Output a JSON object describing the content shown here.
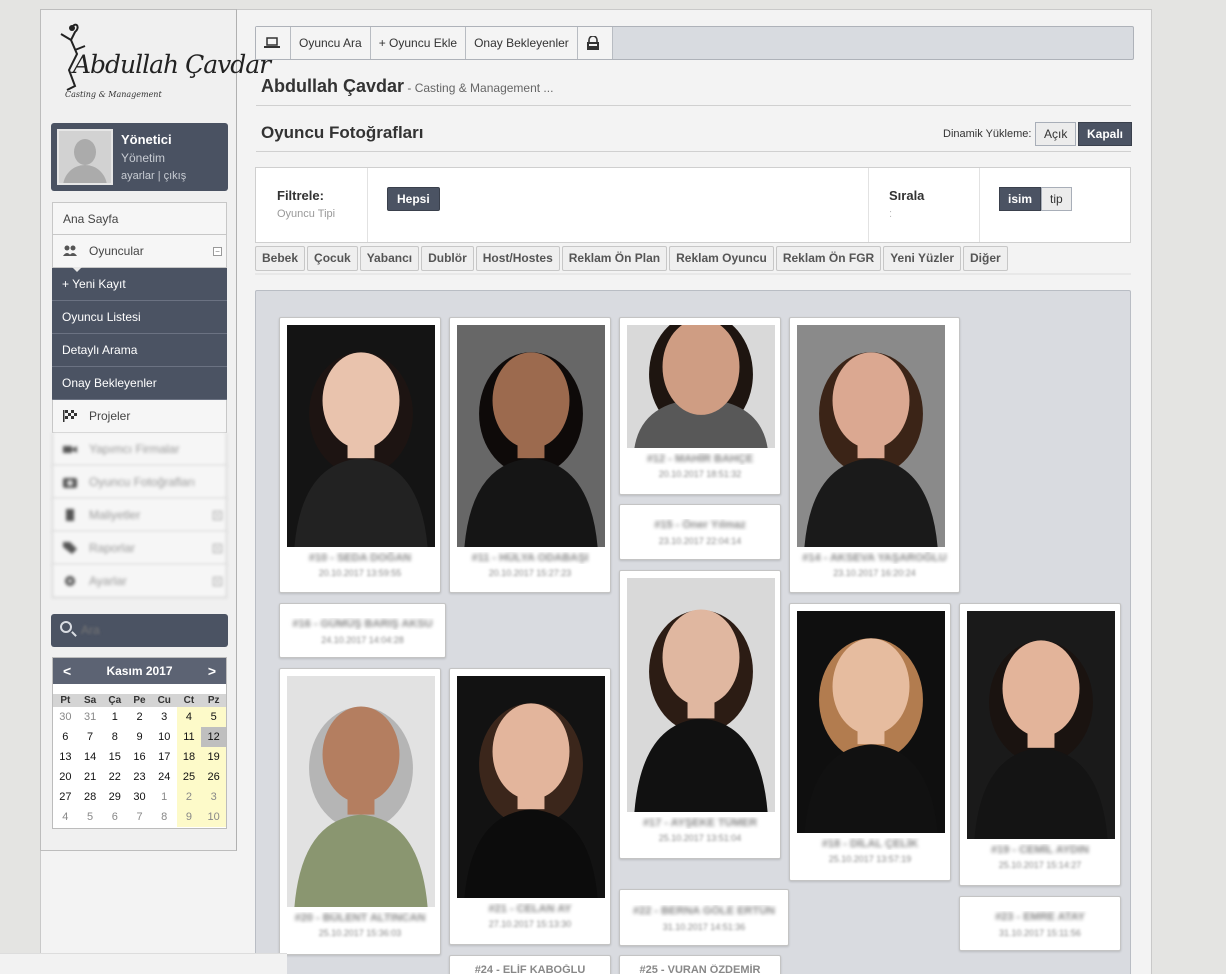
{
  "brand": {
    "logo_text": "Abdullah Çavdar",
    "logo_sub": "Casting & Management"
  },
  "user": {
    "name": "Yönetici",
    "role": "Yönetim",
    "settings": "ayarlar",
    "sep": "|",
    "logout": "çıkış"
  },
  "nav": {
    "home": "Ana Sayfa",
    "players": "Oyuncular",
    "players_toggle": "−",
    "sub": [
      "+ Yeni Kayıt",
      "Oyuncu Listesi",
      "Detaylı Arama",
      "Onay Bekleyenler"
    ],
    "projects": "Projeler",
    "producers": "Yapımcı Firmalar",
    "photos": "Oyuncu Fotoğrafları",
    "costs": "Maliyetler",
    "reports": "Raporlar",
    "settings": "Ayarlar",
    "expand": "+"
  },
  "search": {
    "placeholder": "Ara"
  },
  "calendar": {
    "prev": "<",
    "next": ">",
    "month": "Kasım 2017",
    "days": [
      "Pt",
      "Sa",
      "Ça",
      "Pe",
      "Cu",
      "Ct",
      "Pz"
    ],
    "weeks": [
      [
        "30",
        "31",
        "1",
        "2",
        "3",
        "4",
        "5"
      ],
      [
        "6",
        "7",
        "8",
        "9",
        "10",
        "11",
        "12"
      ],
      [
        "13",
        "14",
        "15",
        "16",
        "17",
        "18",
        "19"
      ],
      [
        "20",
        "21",
        "22",
        "23",
        "24",
        "25",
        "26"
      ],
      [
        "27",
        "28",
        "29",
        "30",
        "1",
        "2",
        "3"
      ],
      [
        "4",
        "5",
        "6",
        "7",
        "8",
        "9",
        "10"
      ]
    ],
    "today": "12"
  },
  "toolbar": {
    "search": "Oyuncu Ara",
    "add": "+ Oyuncu Ekle",
    "pending": "Onay Bekleyenler"
  },
  "header": {
    "title": "Abdullah Çavdar",
    "subtitle": " - Casting & Management ..."
  },
  "page": {
    "title": "Oyuncu Fotoğrafları",
    "dynamic_label": "Dinamik Yükleme:",
    "open": "Açık",
    "closed": "Kapalı"
  },
  "filter": {
    "label": "Filtrele:",
    "sub": "Oyuncu Tipi",
    "all": "Hepsi",
    "sort_label": "Sırala",
    "sort_sub": ":",
    "sort_name": "isim",
    "sort_type": "tip"
  },
  "categories": [
    "Bebek",
    "Çocuk",
    "Yabancı",
    "Dublör",
    "Host/Hostes",
    "Reklam Ön Plan",
    "Reklam Oyuncu",
    "Reklam Ön FGR",
    "Yeni Yüzler",
    "Diğer"
  ],
  "cards": [
    {
      "name": "#10 - SEDA DOĞAN",
      "date": "20.10.2017 13:59:55"
    },
    {
      "name": "#11 - HÜLYA ODABAŞI",
      "date": "20.10.2017 15:27:23"
    },
    {
      "name": "#12 - MAHİR BAHÇE",
      "date": "20.10.2017 18:51:32"
    },
    {
      "name": "#15 - Öner Yılmaz",
      "date": "23.10.2017 22:04:14"
    },
    {
      "name": "#14 - AKSEVA YAŞAROĞLU",
      "date": "23.10.2017 16:20:24"
    },
    {
      "name": "#16 - GÜMÜŞ BARIŞ AKSU",
      "date": "24.10.2017 14:04:28"
    },
    {
      "name": "#17 - AYŞEKE TÜMER",
      "date": "25.10.2017 13:51:04"
    },
    {
      "name": "#18 - DİLAL ÇELİK",
      "date": "25.10.2017 13:57:19"
    },
    {
      "name": "#19 - CEMİL AYDIN",
      "date": "25.10.2017 15:14:27"
    },
    {
      "name": "#20 - BÜLENT ALTINCAN",
      "date": "25.10.2017 15:36:03"
    },
    {
      "name": "#21 - CELAN AY",
      "date": "27.10.2017 15:13:30"
    },
    {
      "name": "#22 - BERNA GÖLE ERTÜN",
      "date": "31.10.2017 14:51:36"
    },
    {
      "name": "#23 - EMRE ATAY",
      "date": "31.10.2017 15:11:56"
    },
    {
      "name": "#24 - ELİF KABOĞLU",
      "date": ""
    },
    {
      "name": "#25 - VURAN ÖZDEMİR",
      "date": ""
    }
  ]
}
